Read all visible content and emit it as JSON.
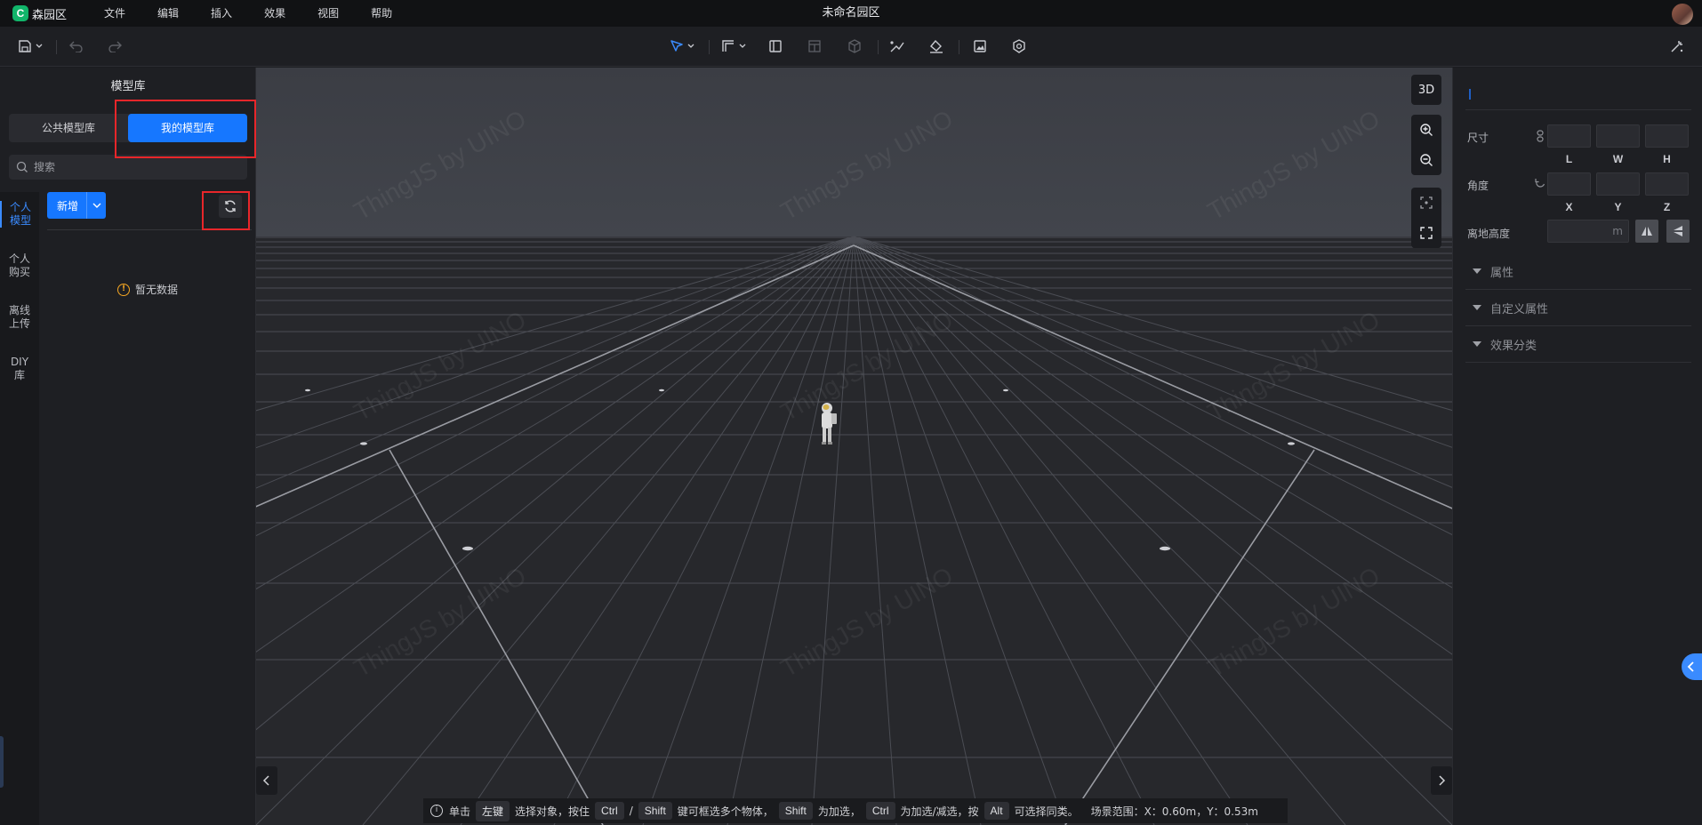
{
  "app": {
    "logo_letter": "C",
    "name": "森园区",
    "doc_title": "未命名园区",
    "accent": "#1677ff"
  },
  "menu": [
    "文件",
    "编辑",
    "插入",
    "效果",
    "视图",
    "帮助"
  ],
  "toolbar": {
    "icons": [
      "save-icon",
      "undo-icon",
      "redo-icon",
      "select-pointer-icon",
      "wall-draw-icon",
      "door-icon",
      "window-icon",
      "cube-icon",
      "path-icon",
      "fill-icon",
      "image-icon",
      "model-icon",
      "effects-icon"
    ]
  },
  "left_panel": {
    "title": "模型库",
    "tabs": [
      "公共模型库",
      "我的模型库"
    ],
    "active_tab": "我的模型库",
    "search_placeholder": "搜索",
    "side_nav": [
      {
        "line1": "个人",
        "line2": "模型",
        "active": true
      },
      {
        "line1": "个人",
        "line2": "购买",
        "active": false
      },
      {
        "line1": "离线",
        "line2": "上传",
        "active": false
      },
      {
        "line1": "DIY",
        "line2": "库",
        "active": false
      }
    ],
    "new_button": "新增",
    "empty_text": "暂无数据"
  },
  "viewport": {
    "watermark": "ThingJS by UINO",
    "view_mode": "3D",
    "status": {
      "t1": "单击",
      "k1": "左键",
      "t2": "选择对象，按住",
      "k2": "Ctrl",
      "t3": "/",
      "k3": "Shift",
      "t4": "键可框选多个物体，",
      "k4": "Shift",
      "t5": "为加选，",
      "k5": "Ctrl",
      "t6": "为加选/减选，按",
      "k6": "Alt",
      "t7": "可选择同类。",
      "range": "场景范围：X：0.60m，Y：0.53m"
    }
  },
  "right_panel": {
    "size_label": "尺寸",
    "size_axes": [
      "L",
      "W",
      "H"
    ],
    "angle_label": "角度",
    "angle_axes": [
      "X",
      "Y",
      "Z"
    ],
    "height_label": "离地高度",
    "height_unit": "m",
    "sections": [
      "属性",
      "自定义属性",
      "效果分类"
    ]
  }
}
